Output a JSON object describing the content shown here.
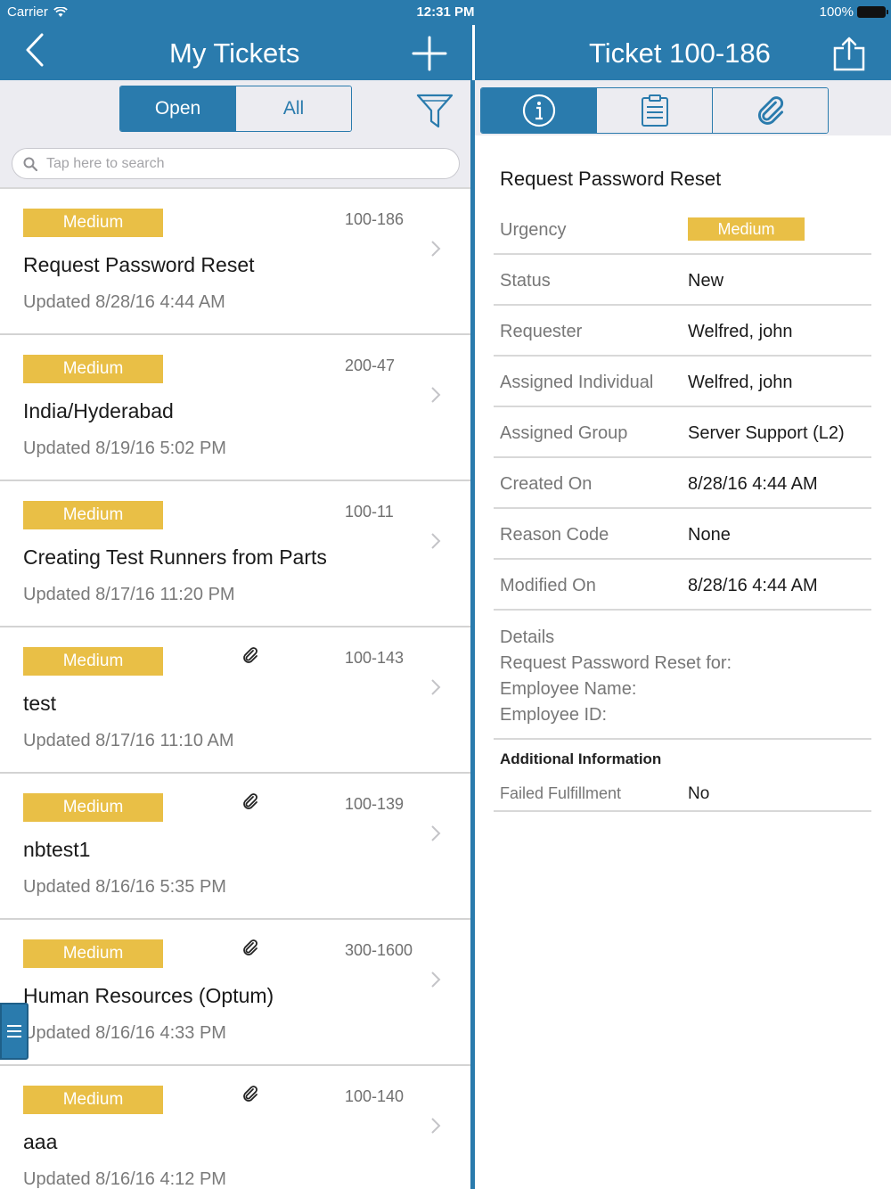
{
  "status_bar": {
    "carrier": "Carrier",
    "time": "12:31 PM",
    "battery": "100%"
  },
  "list_nav": {
    "title": "My Tickets",
    "back_icon": "chevron-left-icon",
    "add_icon": "plus-icon"
  },
  "filter": {
    "open_label": "Open",
    "all_label": "All",
    "filter_icon": "funnel-icon"
  },
  "search": {
    "placeholder": "Tap here to search"
  },
  "tickets": [
    {
      "urgency": "Medium",
      "id": "100-186",
      "title": "Request Password Reset",
      "updated": "Updated 8/28/16 4:44 AM",
      "attachment": false
    },
    {
      "urgency": "Medium",
      "id": "200-47",
      "title": "India/Hyderabad",
      "updated": "Updated 8/19/16 5:02 PM",
      "attachment": false
    },
    {
      "urgency": "Medium",
      "id": "100-11",
      "title": "Creating Test Runners from Parts",
      "updated": "Updated 8/17/16 11:20 PM",
      "attachment": false
    },
    {
      "urgency": "Medium",
      "id": "100-143",
      "title": "test",
      "updated": "Updated 8/17/16 11:10 AM",
      "attachment": true
    },
    {
      "urgency": "Medium",
      "id": "100-139",
      "title": "nbtest1",
      "updated": "Updated 8/16/16 5:35 PM",
      "attachment": true
    },
    {
      "urgency": "Medium",
      "id": "300-1600",
      "title": "Human Resources (Optum)",
      "updated": "Updated 8/16/16 4:33 PM",
      "attachment": true
    },
    {
      "urgency": "Medium",
      "id": "100-140",
      "title": "aaa",
      "updated": "Updated 8/16/16 4:12 PM",
      "attachment": true
    }
  ],
  "detail_nav": {
    "title": "Ticket 100-186",
    "share_icon": "share-icon"
  },
  "detail_tabs": {
    "info_icon": "info-icon",
    "notes_icon": "clipboard-icon",
    "attachments_icon": "paperclip-icon"
  },
  "detail": {
    "title": "Request Password Reset",
    "fields": {
      "urgency": {
        "label": "Urgency",
        "value": "Medium"
      },
      "status": {
        "label": "Status",
        "value": "New"
      },
      "requester": {
        "label": "Requester",
        "value": "Welfred, john"
      },
      "assigned_individual": {
        "label": "Assigned Individual",
        "value": "Welfred, john"
      },
      "assigned_group": {
        "label": "Assigned Group",
        "value": "Server Support (L2)"
      },
      "created_on": {
        "label": "Created On",
        "value": "8/28/16 4:44 AM"
      },
      "reason_code": {
        "label": "Reason Code",
        "value": "None"
      },
      "modified_on": {
        "label": "Modified On",
        "value": "8/28/16 4:44 AM"
      }
    },
    "details_label": "Details",
    "details_lines": [
      "Request Password Reset for:",
      "Employee Name:",
      "Employee ID:"
    ],
    "additional_info_header": "Additional Information",
    "failed_fulfillment": {
      "label": "Failed Fulfillment",
      "value": "No"
    }
  },
  "colors": {
    "primary": "#2a7bad",
    "urgency_medium": "#e9bf46",
    "panel_bg": "#ececf1"
  },
  "side_menu_icon": "hamburger-icon"
}
